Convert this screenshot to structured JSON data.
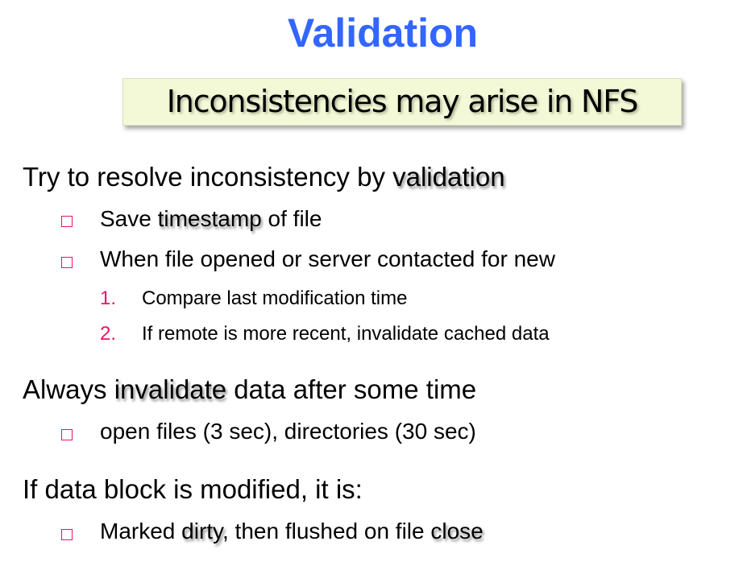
{
  "title": "Validation",
  "callout": "Inconsistencies may arise in NFS",
  "colors": {
    "title": "#3366ff",
    "bullet": "#ee1166",
    "callout_bg": "#f3f9d6"
  },
  "sections": [
    {
      "pre": "Try to resolve inconsistency by ",
      "em": "validation",
      "post": "",
      "bullets": [
        {
          "icon": "hollow-square-bullet",
          "pre": "Save ",
          "em": "timestamp",
          "post": " of file"
        },
        {
          "icon": "hollow-square-bullet",
          "pre": "When file opened or server contacted for new",
          "em": "",
          "post": ""
        }
      ],
      "steps": [
        {
          "num": "1.",
          "text": "Compare last modification time"
        },
        {
          "num": "2.",
          "text": "If remote is more recent, invalidate cached data"
        }
      ]
    },
    {
      "pre": "Always ",
      "em": "invalidate",
      "post": " data after some time",
      "bullets": [
        {
          "icon": "hollow-square-bullet",
          "pre": "open files (3 sec), directories (30 sec)",
          "em": "",
          "post": ""
        }
      ]
    },
    {
      "pre": "If data block is modified, it is:",
      "em": "",
      "post": "",
      "bullets": [
        {
          "icon": "hollow-square-bullet",
          "pre": "Marked ",
          "em": "dirty",
          "post": ", then flushed on file ",
          "em2": "close"
        }
      ]
    }
  ]
}
